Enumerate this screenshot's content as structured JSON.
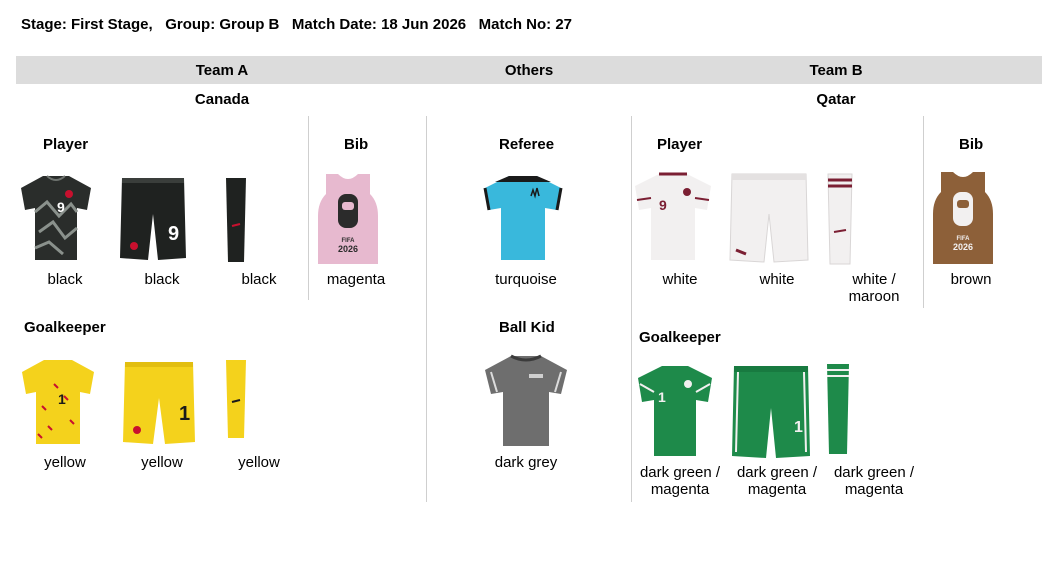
{
  "header": {
    "stage": "Stage: First Stage,",
    "group": "Group: Group B",
    "date": "Match Date: 18 Jun 2026",
    "match_no": "Match No: 27"
  },
  "columns": {
    "team_a": "Team A",
    "others": "Others",
    "team_b": "Team B"
  },
  "team_a": {
    "name": "Canada",
    "player_title": "Player",
    "player": [
      "black",
      "black",
      "black"
    ],
    "bib_title": "Bib",
    "bib": "magenta",
    "gk_title": "Goalkeeper",
    "gk": [
      "yellow",
      "yellow",
      "yellow"
    ]
  },
  "others": {
    "referee_title": "Referee",
    "referee": "turquoise",
    "ballkid_title": "Ball Kid",
    "ballkid": "dark grey"
  },
  "team_b": {
    "name": "Qatar",
    "player_title": "Player",
    "player": [
      "white",
      "white",
      "white /\nmaroon"
    ],
    "bib_title": "Bib",
    "bib": "brown",
    "gk_title": "Goalkeeper",
    "gk": [
      "dark green /\nmagenta",
      "dark green /\nmagenta",
      "dark green /\nmagenta"
    ]
  },
  "colors": {
    "black": "#2a2d2b",
    "yellow": "#f4d21c",
    "magenta": "#e7b9cf",
    "turquoise": "#39b8dc",
    "darkgrey": "#6e6e6e",
    "white": "#f2f0f0",
    "maroon": "#7b1f33",
    "brown": "#8d6039",
    "darkgreen": "#1e8a4a"
  },
  "icons": [
    "jersey-icon",
    "shorts-icon",
    "sock-icon",
    "bib-icon"
  ]
}
